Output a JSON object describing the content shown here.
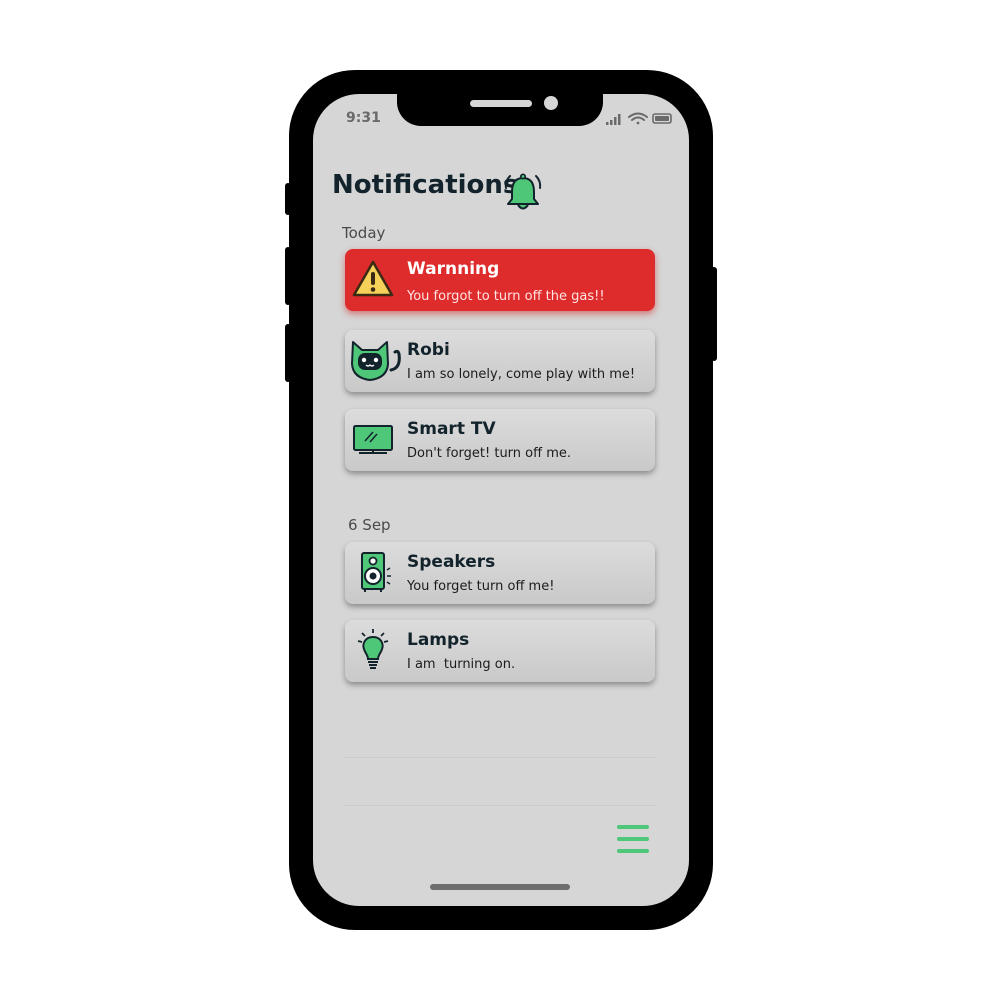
{
  "status_bar": {
    "time": "9:31",
    "icons": [
      "signal-icon",
      "wifi-icon",
      "battery-icon"
    ]
  },
  "header": {
    "title": "Notifications",
    "icon": "bell-icon"
  },
  "colors": {
    "accent": "#4fc779",
    "warning": "#de2b2b",
    "screen_bg": "#d6d6d6",
    "text_dark": "#13232c"
  },
  "sections": [
    {
      "label": "Today",
      "notifications": [
        {
          "icon": "warning-icon",
          "title": "Warnning",
          "message": "You forgot to turn off the gas!!",
          "type": "warning"
        },
        {
          "icon": "cat-robot-icon",
          "title": "Robi",
          "message": "I am so lonely, come play with me!",
          "type": "normal"
        },
        {
          "icon": "tv-icon",
          "title": "Smart TV",
          "message": "Don't forget! turn off me.",
          "type": "normal"
        }
      ]
    },
    {
      "label": "6 Sep",
      "notifications": [
        {
          "icon": "speaker-icon",
          "title": "Speakers",
          "message": "You forget turn off me!",
          "type": "normal"
        },
        {
          "icon": "lamp-icon",
          "title": "Lamps",
          "message": "I am  turning on.",
          "type": "normal"
        }
      ]
    }
  ],
  "footer": {
    "menu_icon": "menu-icon"
  }
}
